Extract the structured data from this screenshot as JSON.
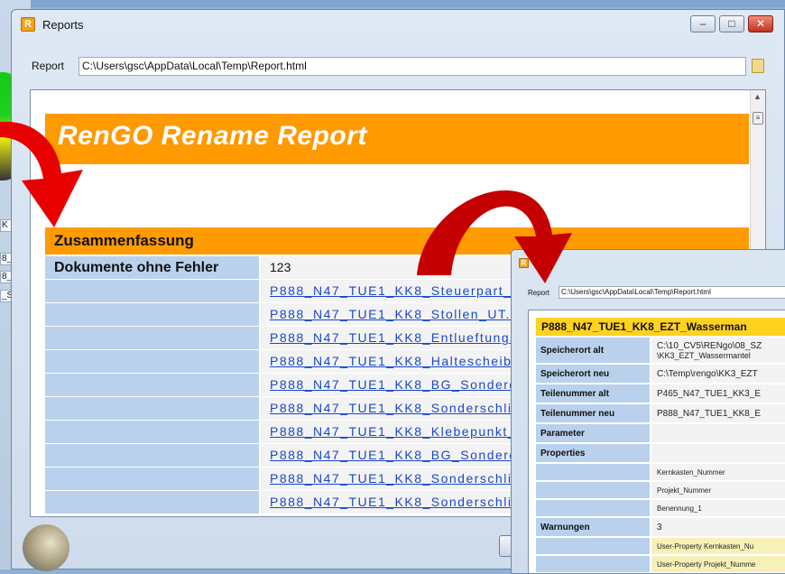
{
  "background_cells": [
    "K",
    "8_",
    "8_",
    "_St"
  ],
  "main_window": {
    "title": "Reports",
    "app_icon_letter": "R",
    "controls": {
      "minimize": "–",
      "maximize": "□",
      "close": "✕"
    },
    "report_label": "Report",
    "report_path": "C:\\Users\\gsc\\AppData\\Local\\Temp\\Report.html",
    "browser": {
      "banner_title": "RenGO Rename Report",
      "summary_header": "Zusammenfassung",
      "rows": [
        {
          "label": "Dokumente ohne Fehler",
          "value": "123"
        },
        {
          "label": "",
          "link": "P888_N47_TUE1_KK8_Steuerpart_EZ"
        },
        {
          "label": "",
          "link": "P888_N47_TUE1_KK8_Stollen_UT.CA"
        },
        {
          "label": "",
          "link": "P888_N47_TUE1_KK8_Entlueftungse"
        },
        {
          "label": "",
          "link": "P888_N47_TUE1_KK8_Haltescheibe_"
        },
        {
          "label": "",
          "link": "P888_N47_TUE1_KK8_BG_Sonderdu"
        },
        {
          "label": "",
          "link": "P888_N47_TUE1_KK8_Sonderschlitz"
        },
        {
          "label": "",
          "link": "P888_N47_TUE1_KK8_Klebepunkt_W"
        },
        {
          "label": "",
          "link": "P888_N47_TUE1_KK8_BG_Sonderdu"
        },
        {
          "label": "",
          "link": "P888_N47_TUE1_KK8_Sonderschlitz"
        },
        {
          "label": "",
          "link": "P888_N47_TUE1_KK8_Sonderschlitz"
        }
      ]
    }
  },
  "detail_window": {
    "title": "Rep",
    "app_icon_letter": "R",
    "report_label": "Report",
    "report_path": "C:\\Users\\gsc\\AppData\\Local\\Temp\\Report.html",
    "header": "P888_N47_TUE1_KK8_EZT_Wasserman",
    "rows": [
      {
        "label": "Speicherort alt",
        "line1": "C:\\10_CV5\\RENgo\\08_SZ",
        "line2": "\\KK3_EZT_Wassermantel"
      },
      {
        "label": "Speicherort neu",
        "value": "C:\\Temp\\rengo\\KK3_EZT"
      },
      {
        "label": "Teilenummer alt",
        "value": "P465_N47_TUE1_KK3_E"
      },
      {
        "label": "Teilenummer neu",
        "value": "P888_N47_TUE1_KK8_E"
      },
      {
        "label": "Parameter",
        "value": ""
      },
      {
        "label": "Properties",
        "value": ""
      },
      {
        "label": "",
        "value": "Kernkasten_Nummer"
      },
      {
        "label": "",
        "value": "Projekt_Nummer"
      },
      {
        "label": "",
        "value": "Benennung_1"
      },
      {
        "label": "Warnungen",
        "value": "3"
      },
      {
        "label": "",
        "value": "User-Property Kernkasten_Nu",
        "warn": true
      },
      {
        "label": "",
        "value": "User-Property Projekt_Numme",
        "warn": true
      }
    ]
  },
  "colors": {
    "banner": "#ff9a00",
    "label_cell": "#b9d1ec",
    "detail_header": "#ffd21f",
    "arrow": "#e60000"
  }
}
